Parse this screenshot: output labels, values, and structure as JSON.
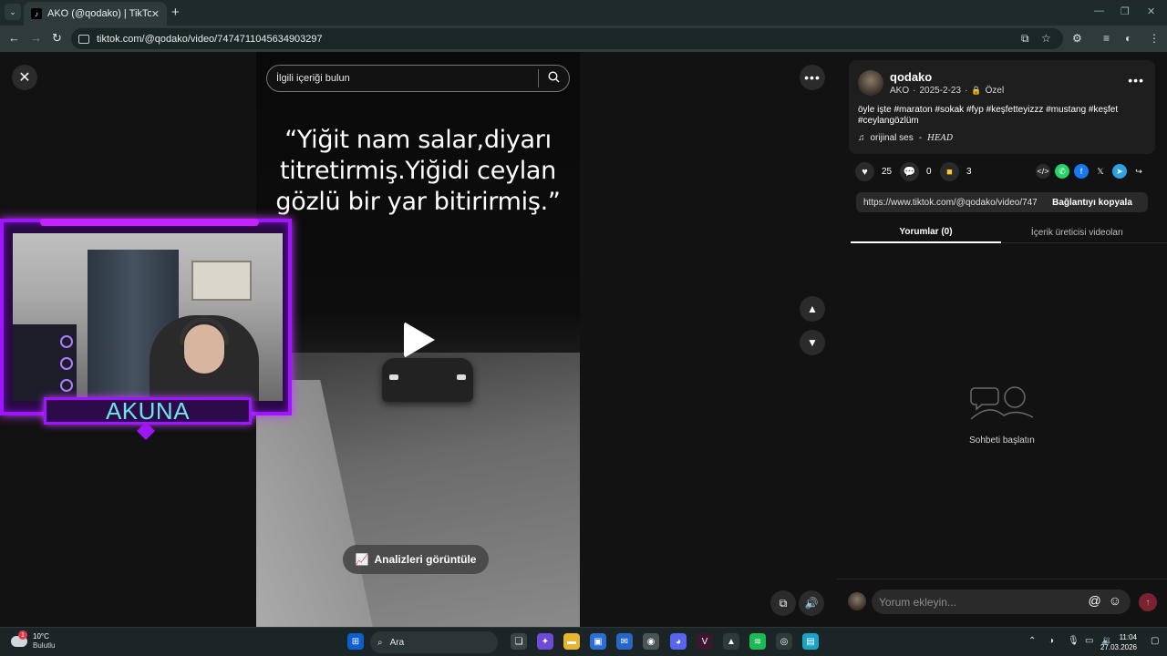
{
  "browser": {
    "tab_title": "AKO (@qodako) | TikTok",
    "tab_favicon": "tiktok-icon",
    "url": "tiktok.com/@qodako/video/7474711045634903297"
  },
  "video": {
    "search_placeholder": "İlgili içeriği bulun",
    "quote": "“Yiğit nam salar,diyarı titretirmiş.Yiğidi ceylan gözlü bir yar bitirirmiş.”",
    "analytics_label": "Analizleri görüntüle"
  },
  "overlay": {
    "streamer_name": "AKUNA"
  },
  "post": {
    "username": "qodako",
    "display_name": "AKO",
    "date": "2025-2-23",
    "privacy": "Özel",
    "description": "öyle işte #maraton #sokak #fyp #keşfetteyizzz #mustang #keşfet #ceylangözlüm",
    "sound": "orijinal ses",
    "sound_artist": "HEAD",
    "likes": "25",
    "comments": "0",
    "saves": "3",
    "link": "https://www.tiktok.com/@qodako/video/7474...",
    "copy_label": "Bağlantıyı kopyala"
  },
  "tabs": {
    "comments": "Yorumlar (0)",
    "creator_videos": "İçerik üreticisi videoları"
  },
  "comments": {
    "empty_text": "Sohbeti başlatın",
    "input_placeholder": "Yorum ekleyin..."
  },
  "taskbar": {
    "temperature": "10°C",
    "weather": "Bulutlu",
    "weather_badge": "1",
    "search_label": "Ara",
    "time": "11:04",
    "date": "27.03.2026"
  },
  "colors": {
    "overlay_accent": "#a015ff",
    "name_color": "#6de3e8",
    "like_color": "#ffffff",
    "save_color": "#ffc52b",
    "whatsapp": "#25d366",
    "facebook": "#1877f2",
    "telegram": "#2aa3df"
  }
}
